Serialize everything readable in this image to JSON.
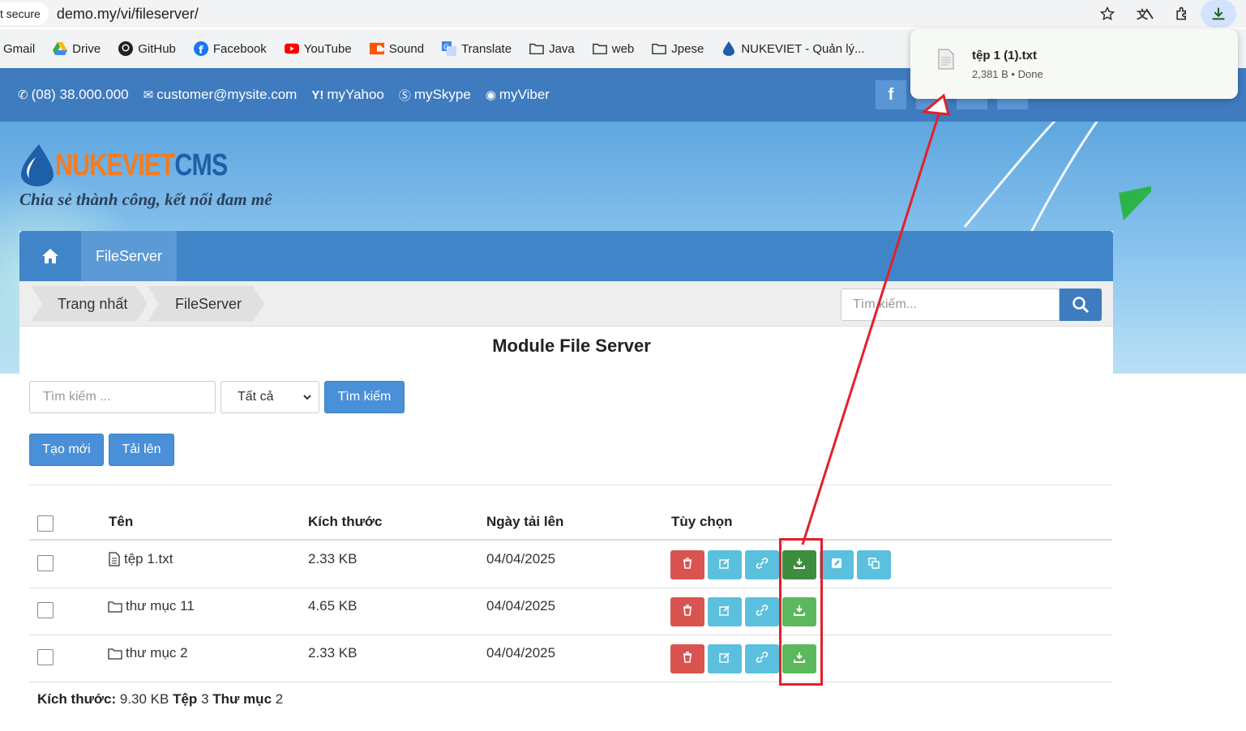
{
  "browser": {
    "security_label": "t secure",
    "url": "demo.my/vi/fileserver/",
    "icons": [
      "star-icon",
      "translate-extension-icon",
      "extensions-icon",
      "download-icon"
    ],
    "bookmarks": [
      {
        "label": "Gmail",
        "icon": "gmail-icon"
      },
      {
        "label": "Drive",
        "icon": "drive-icon"
      },
      {
        "label": "GitHub",
        "icon": "github-icon"
      },
      {
        "label": "Facebook",
        "icon": "facebook-icon"
      },
      {
        "label": "YouTube",
        "icon": "youtube-icon"
      },
      {
        "label": "Sound",
        "icon": "soundcloud-icon"
      },
      {
        "label": "Translate",
        "icon": "translate-icon"
      },
      {
        "label": "Java",
        "icon": "folder-icon"
      },
      {
        "label": "web",
        "icon": "folder-icon"
      },
      {
        "label": "Jpese",
        "icon": "folder-icon"
      },
      {
        "label": "NUKEVIET - Quản lý...",
        "icon": "nukeviet-icon"
      }
    ]
  },
  "download_popup": {
    "filename": "tệp 1 (1).txt",
    "meta": "2,381 B • Done"
  },
  "topbar": {
    "phone": "(08) 38.000.000",
    "email": "customer@mysite.com",
    "yahoo": "myYahoo",
    "skype": "mySkype",
    "viber": "myViber",
    "color": "#3e7bbf"
  },
  "banner": {
    "logo_part1": "NUKEVIET",
    "logo_part2": "CMS",
    "slogan": "Chia sẻ thành công, kết nối đam mê"
  },
  "nav": {
    "tab_label": "FileServer"
  },
  "breadcrumb": {
    "items": [
      "Trang nhất",
      "FileServer"
    ]
  },
  "top_search": {
    "placeholder": "Tìm kiếm..."
  },
  "page_title": "Module File Server",
  "filter": {
    "search_placeholder": "Tìm kiếm ...",
    "type_selected": "Tất cả",
    "search_button": "Tìm kiếm"
  },
  "actions": {
    "create": "Tạo mới",
    "upload": "Tải lên"
  },
  "table": {
    "headers": {
      "name": "Tên",
      "size": "Kích thước",
      "date": "Ngày tải lên",
      "options": "Tùy chọn"
    },
    "rows": [
      {
        "type": "file",
        "name": "tệp 1.txt",
        "size": "2.33 KB",
        "date": "04/04/2025"
      },
      {
        "type": "folder",
        "name": "thư mục 11",
        "size": "4.65 KB",
        "date": "04/04/2025"
      },
      {
        "type": "folder",
        "name": "thư mục 2",
        "size": "2.33 KB",
        "date": "04/04/2025"
      }
    ]
  },
  "summary": {
    "size_label": "Kích thước:",
    "size_value": "9.30 KB",
    "files_label": "Tệp",
    "files_value": "3",
    "folders_label": "Thư mục",
    "folders_value": "2"
  },
  "annotation_color": "#e3202a"
}
